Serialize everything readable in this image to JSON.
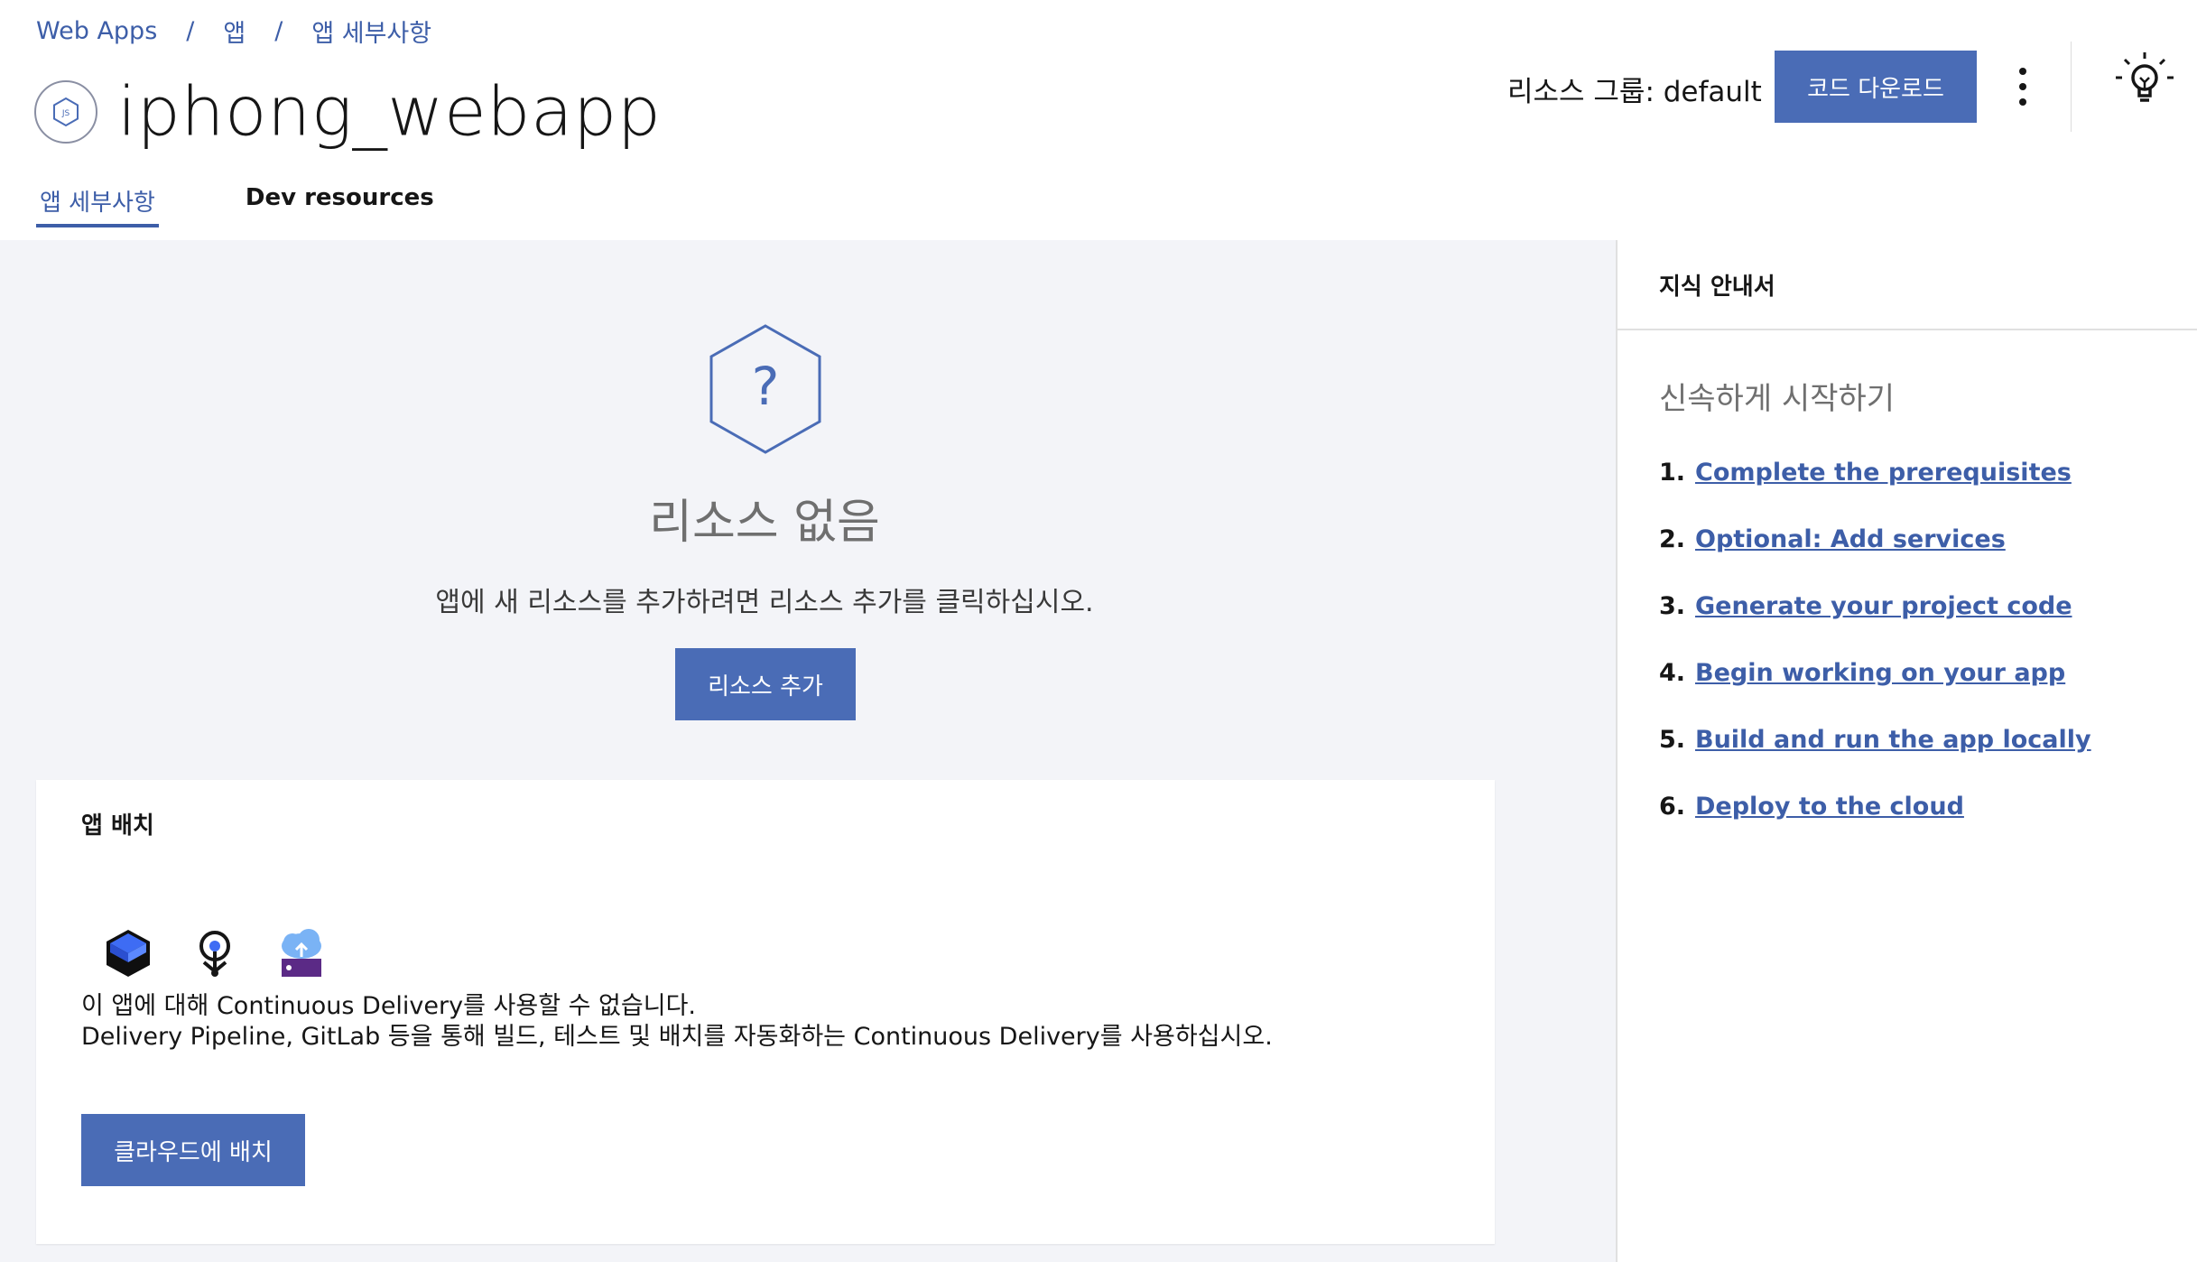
{
  "breadcrumb": {
    "items": [
      "Web Apps",
      "앱",
      "앱 세부사항"
    ],
    "separator": "/"
  },
  "app": {
    "title": "iphong_webapp",
    "icon": "hexagon-badge-icon"
  },
  "tabs": [
    {
      "label": "앱 세부사항",
      "active": true
    },
    {
      "label": "Dev resources",
      "active": false
    }
  ],
  "header": {
    "resource_group_label": "리소스 그룹: default",
    "download_button": "코드 다운로드",
    "overflow_icon": "overflow-menu-icon",
    "help_icon": "lightbulb-icon"
  },
  "empty_state": {
    "icon": "question-hexagon-icon",
    "title": "리소스 없음",
    "description": "앱에 새 리소스를 추가하려면 리소스 추가를 클릭하십시오.",
    "add_button": "리소스 추가"
  },
  "deploy_card": {
    "title": "앱 배치",
    "icons": [
      "delivery-pipeline-icon",
      "gitlab-icon",
      "cloud-deploy-icon"
    ],
    "line1": "이 앱에 대해 Continuous Delivery를 사용할 수 없습니다.",
    "line2": "Delivery Pipeline, GitLab 등을 통해 빌드, 테스트 및 배치를 자동화하는 Continuous Delivery를 사용하십시오.",
    "deploy_button": "클라우드에 배치"
  },
  "side_panel": {
    "title": "지식 안내서",
    "subtitle": "신속하게 시작하기",
    "steps": [
      {
        "num": "1.",
        "label": "Complete the prerequisites"
      },
      {
        "num": "2.",
        "label": "Optional: Add services"
      },
      {
        "num": "3.",
        "label": "Generate your project code"
      },
      {
        "num": "4.",
        "label": "Begin working on your app"
      },
      {
        "num": "5.",
        "label": "Build and run the app locally"
      },
      {
        "num": "6.",
        "label": "Deploy to the cloud"
      }
    ]
  },
  "colors": {
    "accent": "#4a6cb6",
    "link": "#3d5ea8",
    "main_bg": "#f3f4f8"
  }
}
